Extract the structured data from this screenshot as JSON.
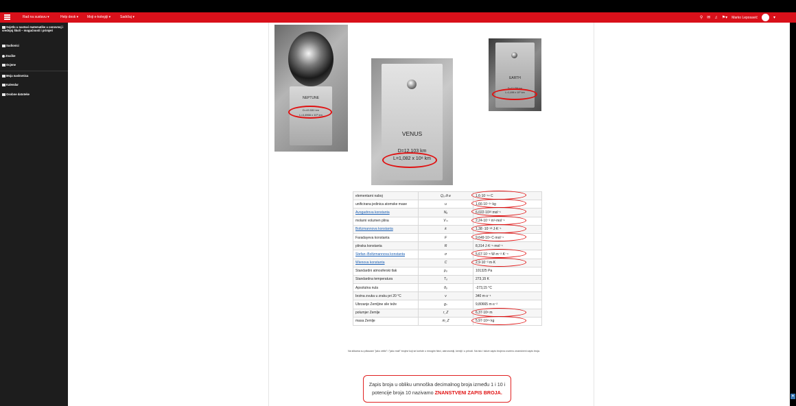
{
  "navbar": {
    "items": [
      "Rad na sustavu ▾",
      "Help desk ▾",
      "Moji e-kolegiji ▾",
      "Sadržaj ▾"
    ],
    "user": "Marko Leposavić",
    "user_caret": "▾",
    "flag_caret": "▾"
  },
  "sidebar": {
    "course": "Svjetlo u nastavi matematike u osnovnoj i srednjoj školi – mogućnosti i primjeri",
    "items": [
      "Sudionici",
      "Značke",
      "Ocjene"
    ],
    "items2": [
      "Moja naslovnica",
      "Kalendar",
      "Osobne datoteke"
    ]
  },
  "images": {
    "neptune": {
      "name": "NEPTUNE",
      "d": "D=49.530 km",
      "l": "L=4,4966 x 10⁹ km"
    },
    "venus": {
      "name": "VENUS",
      "d": "D=12.103 km",
      "l": "L=1,082 x 10⁸ km"
    },
    "earth": {
      "name": "EARTH",
      "d": "D=12.756 km",
      "l": "L=1,496 x 10⁸ km"
    }
  },
  "table": {
    "rows": [
      {
        "name": "elementarni naboj",
        "sym": "Q₀ ili e",
        "val": "1,6·10⁻¹⁹ C",
        "link": false
      },
      {
        "name": "unificirana jedinica atomske mase",
        "sym": "u",
        "val": "1,66·10⁻²⁷ kg",
        "link": false
      },
      {
        "name": "Avogadrova konstanta",
        "sym": "Nₐ",
        "val": "6,022·10²³ mol⁻¹",
        "link": true
      },
      {
        "name": "molarni volumen plina",
        "sym": "Vₘ",
        "val": "2,24·10⁻² m³·mol⁻¹",
        "link": false
      },
      {
        "name": "Boltzmannova konstanta",
        "sym": "k",
        "val": "1,38 ·10⁻²³ J·K⁻¹",
        "link": true
      },
      {
        "name": "Faradayeva konstanta",
        "sym": "F",
        "val": "9,649·10⁴ C·mol⁻¹",
        "link": false
      },
      {
        "name": "plinska konstanta",
        "sym": "R",
        "val": "8,314 J·K⁻¹·mol⁻¹",
        "link": false
      },
      {
        "name": "Stefan–Boltzmannova konstanta",
        "sym": "σ",
        "val": "5,67·10⁻⁸ W·m⁻²·K⁻⁴",
        "link": true
      },
      {
        "name": "Wienova konstanta",
        "sym": "C",
        "val": "2,9·10⁻³ m·K",
        "link": true
      },
      {
        "name": "Standardni atmosferski tlak",
        "sym": "p₀",
        "val": "101325 Pa",
        "link": false
      },
      {
        "name": "Standardna temperatura",
        "sym": "T₀",
        "val": "273,15 K",
        "link": false
      },
      {
        "name": "Apsolutna nula",
        "sym": "θ₀",
        "val": "-273,15 °C",
        "link": false
      },
      {
        "name": "brzina zvuka u zraku pri 20 °C",
        "sym": "v",
        "val": "340 m·s⁻¹",
        "link": false
      },
      {
        "name": "Ubrzanje Zemljine sile teže",
        "sym": "gₙ",
        "val": "9,80665 m·s⁻²",
        "link": false
      },
      {
        "name": "polumjer Zemlje",
        "sym": "r_Z",
        "val": "6,37·10⁶ m",
        "link": false
      },
      {
        "name": "masa Zemlje",
        "sym": "m_Z",
        "val": "5,97·10²⁴ kg",
        "link": false
      }
    ]
  },
  "note": "Na slikama su prikazani \"jako veliki\" i \"jako mali\" brojevi koji se koriste u mnogim fizici, astronomiji, kemiji i u prirodi. Na isto i takve zapis brojeva zovemo znanstveni zapis broja.",
  "definition": {
    "line1": "Zapis broja u obliku umnoška decimalnog broja između 1 i 10 i",
    "line2": "potencije broja 10 nazivamo",
    "highlight": "ZNANSTVENI ZAPIS BROJA."
  },
  "colors": {
    "brand": "#d9101a",
    "ring": "#e01010",
    "sidebar": "#1d1d1d"
  }
}
